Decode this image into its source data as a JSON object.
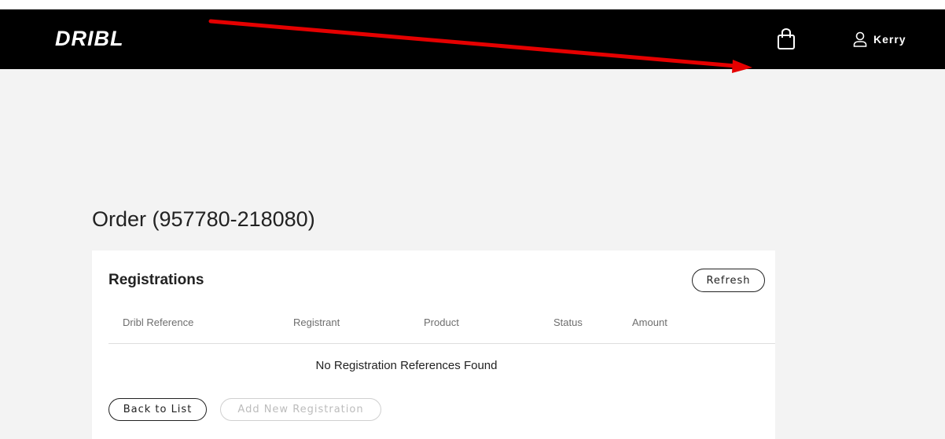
{
  "header": {
    "logo_text": "DRIBL",
    "cart_icon": "shopping-bag-icon",
    "user_icon": "user-icon",
    "user_name": "Kerry"
  },
  "page": {
    "title": "Order (957780-218080)"
  },
  "registrations": {
    "title": "Registrations",
    "refresh_label": "Refresh",
    "columns": [
      "Dribl Reference",
      "Registrant",
      "Product",
      "Status",
      "Amount"
    ],
    "empty_message": "No Registration References Found",
    "back_label": "Back to List",
    "add_label": "Add New Registration"
  },
  "colors": {
    "navbar": "#000000",
    "background": "#f3f3f3",
    "annotation_arrow": "#e50000"
  }
}
